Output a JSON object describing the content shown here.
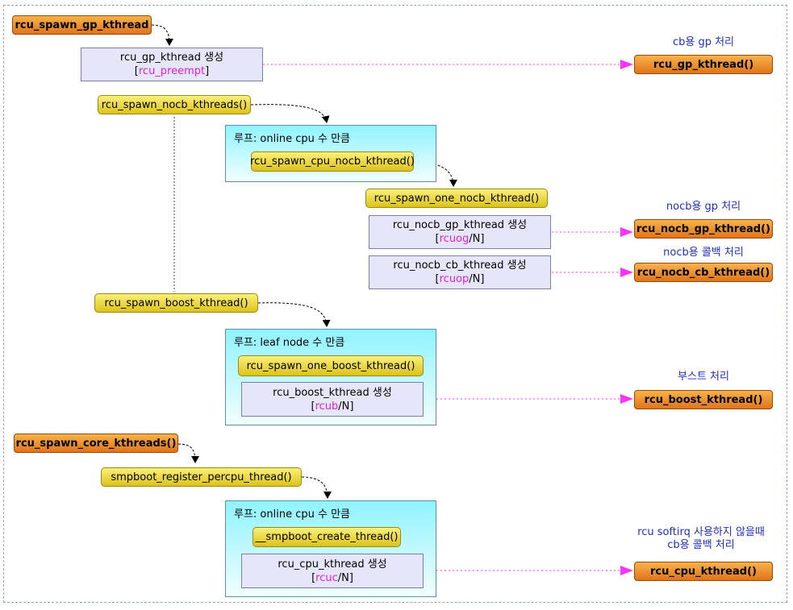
{
  "notes": {
    "cb_gp": "cb용 gp 처리",
    "nocb_gp": "nocb용 gp 처리",
    "nocb_cb": "nocb용 콜백 처리",
    "boost": "부스트 처리",
    "softirq_line1": "rcu softirq 사용하지 않을때",
    "softirq_line2": "cb용 콜백 처리"
  },
  "nodes": {
    "spawn_gp": "rcu_spawn_gp_kthread",
    "gp_create": "rcu_gp_kthread 생성",
    "gp_thread_name": "rcu_preempt",
    "spawn_nocb": "rcu_spawn_nocb_kthreads()",
    "loop1_title": "루프: online cpu 수 만큼",
    "spawn_cpu_nocb": "rcu_spawn_cpu_nocb_kthread()",
    "spawn_one_nocb": "rcu_spawn_one_nocb_kthread()",
    "nocb_gp_create": "rcu_nocb_gp_kthread 생성",
    "nocb_gp_name": "rcuog",
    "nocb_gp_suffix": "/N]",
    "nocb_cb_create": "rcu_nocb_cb_kthread 생성",
    "nocb_cb_name": "rcuop",
    "nocb_cb_suffix": "/N]",
    "spawn_boost": "rcu_spawn_boost_kthread()",
    "loop2_title": "루프: leaf node 수 만큼",
    "spawn_one_boost": "rcu_spawn_one_boost_kthread()",
    "boost_create": "rcu_boost_kthread 생성",
    "boost_name": "rcub",
    "boost_suffix": "/N]",
    "spawn_core": "rcu_spawn_core_kthreads()",
    "smpboot_reg": "smpboot_register_percpu_thread()",
    "loop3_title": "루프: online cpu 수 만큼",
    "smpboot_create": "__smpboot_create_thread()",
    "cpu_create": "rcu_cpu_kthread 생성",
    "cpu_name": "rcuc",
    "cpu_suffix": "/N]",
    "gp_kthread": "rcu_gp_kthread()",
    "nocb_gp_kthread": "rcu_nocb_gp_kthread()",
    "nocb_cb_kthread": "rcu_nocb_cb_kthread()",
    "boost_kthread": "rcu_boost_kthread()",
    "cpu_kthread": "rcu_cpu_kthread()"
  },
  "bracket_open": "[",
  "bracket_close": "]"
}
